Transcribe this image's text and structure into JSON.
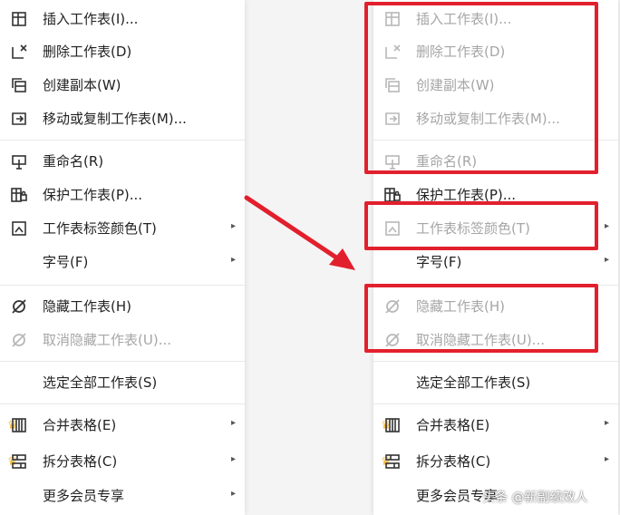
{
  "menu_items": [
    {
      "label": "插入工作表(I)...",
      "icon": "insert-sheet-icon"
    },
    {
      "label": "删除工作表(D)",
      "icon": "delete-sheet-icon"
    },
    {
      "label": "创建副本(W)",
      "icon": "copy-sheet-icon"
    },
    {
      "label": "移动或复制工作表(M)...",
      "icon": "move-copy-icon"
    },
    {
      "label": "重命名(R)",
      "icon": "rename-icon"
    },
    {
      "label": "保护工作表(P)...",
      "icon": "protect-sheet-icon"
    },
    {
      "label": "工作表标签颜色(T)",
      "icon": "tab-color-icon"
    },
    {
      "label": "字号(F)",
      "icon": ""
    },
    {
      "label": "隐藏工作表(H)",
      "icon": "hide-icon"
    },
    {
      "label": "取消隐藏工作表(U)...",
      "icon": "unhide-icon"
    },
    {
      "label": "选定全部工作表(S)",
      "icon": ""
    },
    {
      "label": "合并表格(E)",
      "icon": "merge-table-icon"
    },
    {
      "label": "拆分表格(C)",
      "icon": "split-table-icon"
    },
    {
      "label": "更多会员专享",
      "icon": ""
    }
  ],
  "submenu_arrow": "▸",
  "crown_glyph": "♛",
  "watermark": "头条 @新副绩效人",
  "colors": {
    "highlight": "#e2202d",
    "disabled_text": "#a6a6a6",
    "crown": "#f2b63c"
  }
}
